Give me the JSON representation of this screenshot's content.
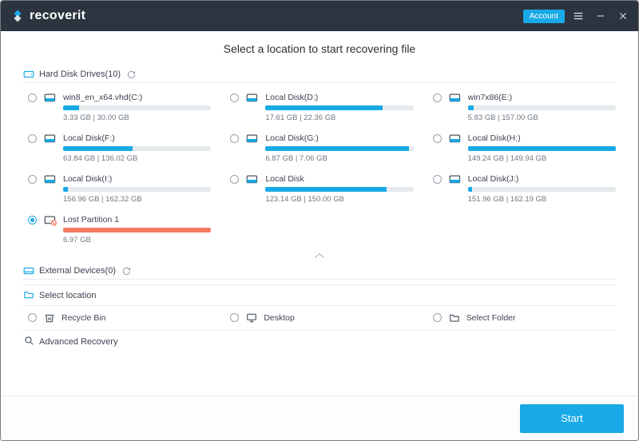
{
  "app": {
    "logo_text": "recoverit",
    "account_label": "Account"
  },
  "page": {
    "title": "Select a location to start recovering file"
  },
  "sections": {
    "hard_disk": {
      "label": "Hard Disk Drives(10)"
    },
    "external": {
      "label": "External Devices(0)"
    },
    "select_location": {
      "label": "Select location"
    },
    "advanced": {
      "label": "Advanced Recovery"
    }
  },
  "drives": [
    {
      "name": "win8_en_x64.vhd(C:)",
      "used": 3.33,
      "total": 30.0,
      "size_text": "3.33 GB | 30.00 GB",
      "selected": false,
      "lost": false
    },
    {
      "name": "Local Disk(D:)",
      "used": 17.61,
      "total": 22.36,
      "size_text": "17.61 GB | 22.36 GB",
      "selected": false,
      "lost": false
    },
    {
      "name": "win7x86(E:)",
      "used": 5.83,
      "total": 157.0,
      "size_text": "5.83 GB | 157.00 GB",
      "selected": false,
      "lost": false
    },
    {
      "name": "Local Disk(F:)",
      "used": 63.84,
      "total": 136.02,
      "size_text": "63.84 GB | 136.02 GB",
      "selected": false,
      "lost": false
    },
    {
      "name": "Local Disk(G:)",
      "used": 6.87,
      "total": 7.06,
      "size_text": "6.87 GB | 7.06 GB",
      "selected": false,
      "lost": false
    },
    {
      "name": "Local Disk(H:)",
      "used": 149.24,
      "total": 149.94,
      "size_text": "149.24 GB | 149.94 GB",
      "selected": false,
      "lost": false
    },
    {
      "name": "Local Disk(I:)",
      "used": 156.96,
      "total": 162.32,
      "size_text": "156.96 GB | 162.32 GB",
      "selected": false,
      "lost": false,
      "fill_override": 3
    },
    {
      "name": "Local Disk",
      "used": 123.14,
      "total": 150.0,
      "size_text": "123.14 GB | 150.00 GB",
      "selected": false,
      "lost": false
    },
    {
      "name": "Local Disk(J:)",
      "used": 151.96,
      "total": 162.19,
      "size_text": "151.96 GB | 162.19 GB",
      "selected": false,
      "lost": false,
      "fill_override": 3
    },
    {
      "name": "Lost Partition 1",
      "used": 6.97,
      "total": 6.97,
      "size_text": "6.97 GB",
      "selected": true,
      "lost": true
    }
  ],
  "select_location": {
    "items": [
      {
        "label": "Recycle Bin",
        "icon": "recycle-bin-icon"
      },
      {
        "label": "Desktop",
        "icon": "desktop-icon"
      },
      {
        "label": "Select Folder",
        "icon": "folder-icon"
      }
    ]
  },
  "footer": {
    "start_label": "Start"
  },
  "colors": {
    "accent": "#18a9e6",
    "lost": "#f37a63",
    "header_bg": "#2c3440"
  }
}
